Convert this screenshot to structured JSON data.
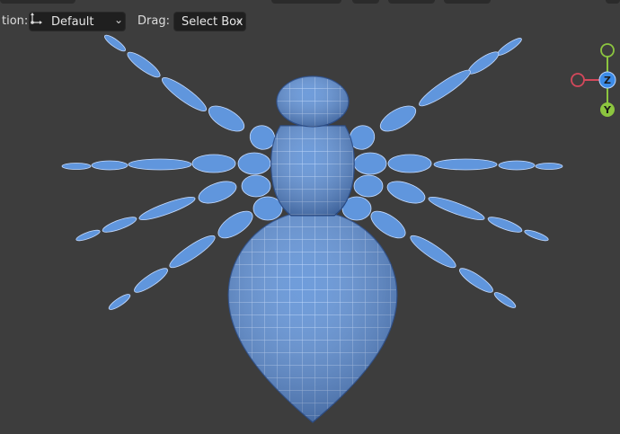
{
  "toolbar": {
    "orientation_label": "tion:",
    "orientation_value": "Default",
    "drag_label": "Drag:",
    "drag_value": "Select Box"
  },
  "gizmo": {
    "z_label": "Z",
    "y_label": "Y",
    "x_color": "#d4485b",
    "y_color": "#8cc53f",
    "z_color": "#3d8ce8"
  },
  "icons": {
    "orientation": "orientation-axis-icon",
    "chevron": "chevron-down-icon"
  },
  "colors": {
    "viewport_bg": "#3d3d3d",
    "mesh_fill": "#5b8fd6",
    "mesh_wire": "#b9d6ff"
  }
}
